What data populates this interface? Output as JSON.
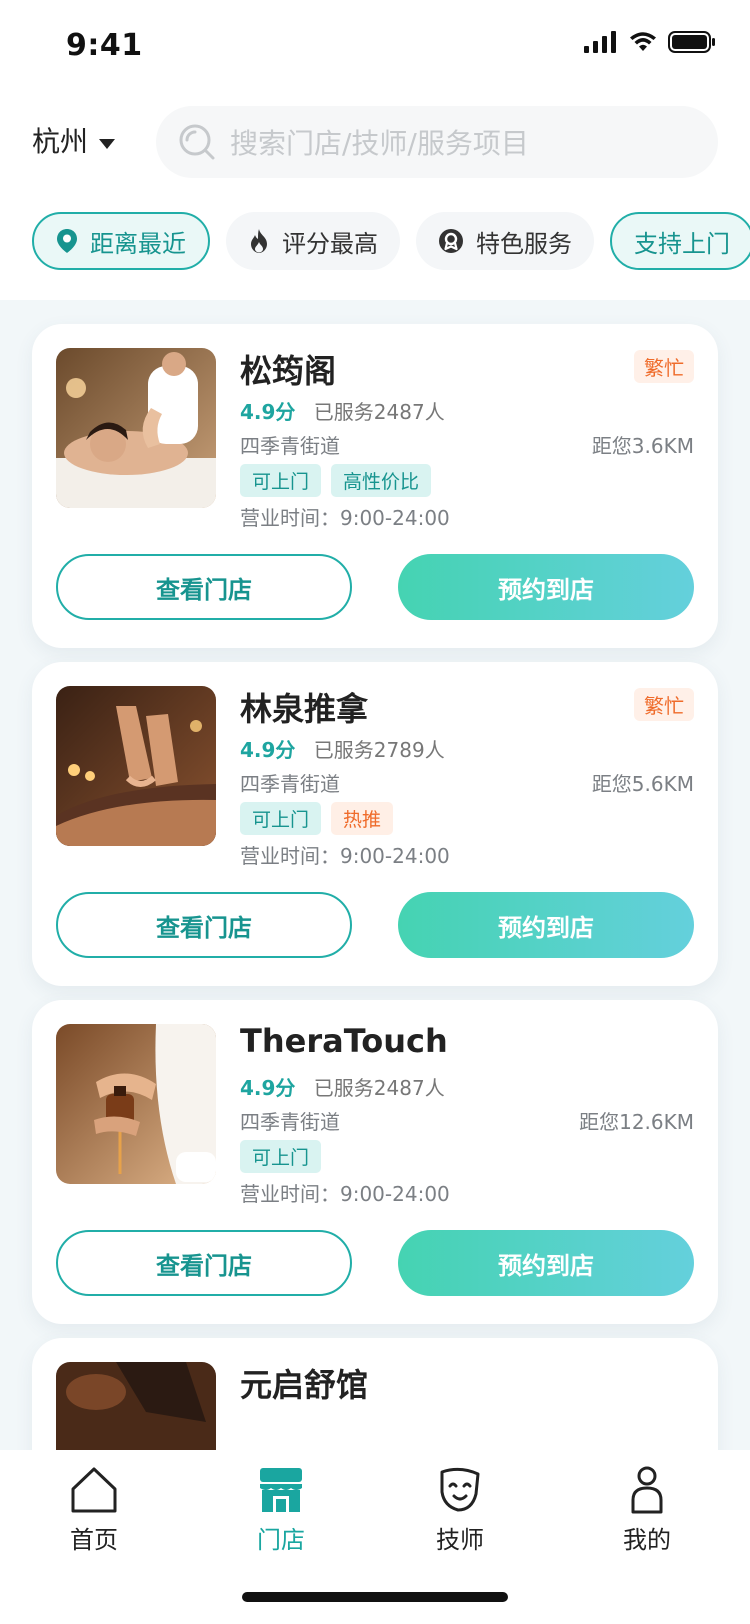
{
  "status_bar": {
    "time": "9:41"
  },
  "header": {
    "city": "杭州",
    "search_placeholder": "搜索门店/技师/服务项目"
  },
  "filters": [
    {
      "label": "距离最近",
      "icon": "location-pin-icon",
      "active": true
    },
    {
      "label": "评分最高",
      "icon": "flame-icon",
      "active": false
    },
    {
      "label": "特色服务",
      "icon": "badge-icon",
      "active": false
    },
    {
      "label": "支持上门",
      "icon": "",
      "active": true
    }
  ],
  "stores": [
    {
      "name": "松筠阁",
      "status": "繁忙",
      "rating": "4.9分",
      "served": "已服务2487人",
      "street": "四季青街道",
      "distance": "距您3.6KM",
      "tags": [
        "可上门",
        "高性价比"
      ],
      "hours": "营业时间：9:00-24:00",
      "view_label": "查看门店",
      "book_label": "预约到店"
    },
    {
      "name": "林泉推拿",
      "status": "繁忙",
      "rating": "4.9分",
      "served": "已服务2789人",
      "street": "四季青街道",
      "distance": "距您5.6KM",
      "tags": [
        "可上门",
        "热推"
      ],
      "hours": "营业时间：9:00-24:00",
      "view_label": "查看门店",
      "book_label": "预约到店"
    },
    {
      "name": "TheraTouch",
      "status": "",
      "rating": "4.9分",
      "served": "已服务2487人",
      "street": "四季青街道",
      "distance": "距您12.6KM",
      "tags": [
        "可上门"
      ],
      "hours": "营业时间：9:00-24:00",
      "view_label": "查看门店",
      "book_label": "预约到店"
    },
    {
      "name": "元启舒馆"
    }
  ],
  "bottom_nav": [
    {
      "label": "首页",
      "icon": "home-icon",
      "active": false
    },
    {
      "label": "门店",
      "icon": "store-icon",
      "active": true
    },
    {
      "label": "技师",
      "icon": "technician-mask-icon",
      "active": false
    },
    {
      "label": "我的",
      "icon": "profile-icon",
      "active": false
    }
  ],
  "colors": {
    "accent": "#1ea5a0",
    "busy": "#ef6b2a",
    "list_bg": "#f2f7f9"
  }
}
